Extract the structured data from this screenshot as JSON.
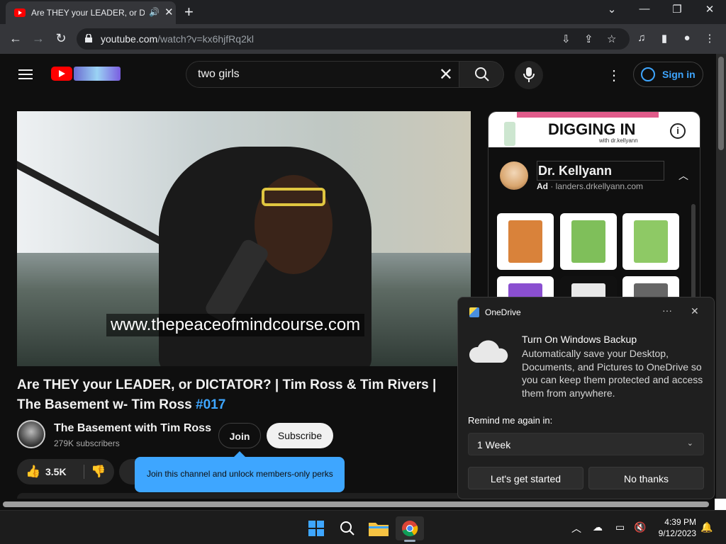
{
  "browser": {
    "tab_title": "Are THEY your LEADER, or DI",
    "url_host": "youtube.com",
    "url_path": "/watch?v=kx6hjfRq2kl"
  },
  "youtube": {
    "search_query": "two girls",
    "signin_label": "Sign in",
    "video": {
      "caption_overlay": "www.thepeaceofmindcourse.com",
      "title_text": "Are THEY your LEADER, or DICTATOR? | Tim Ross & Tim Rivers | The Basement w- Tim Ross ",
      "title_tag": "#017"
    },
    "channel": {
      "name": "The Basement with Tim Ross",
      "subscribers": "279K subscribers",
      "join_label": "Join",
      "subscribe_label": "Subscribe"
    },
    "likes": "3.5K",
    "join_tooltip": "Join this channel and unlock members-only perks",
    "ad": {
      "banner_title": "DIGGING IN",
      "banner_sub": "with dr.kellyann",
      "advertiser": "Dr. Kellyann",
      "ad_label": "Ad",
      "ad_domain": " · landers.drkellyann.com"
    }
  },
  "toast": {
    "app": "OneDrive",
    "title": "Turn On Windows Backup",
    "body": "Automatically save your Desktop, Documents, and Pictures to OneDrive so you can keep them protected and access them from anywhere.",
    "remind_label": "Remind me again in:",
    "remind_value": "1 Week",
    "primary_button": "Let's get started",
    "secondary_button": "No thanks"
  },
  "taskbar": {
    "time": "4:39 PM",
    "date": "9/12/2023"
  }
}
